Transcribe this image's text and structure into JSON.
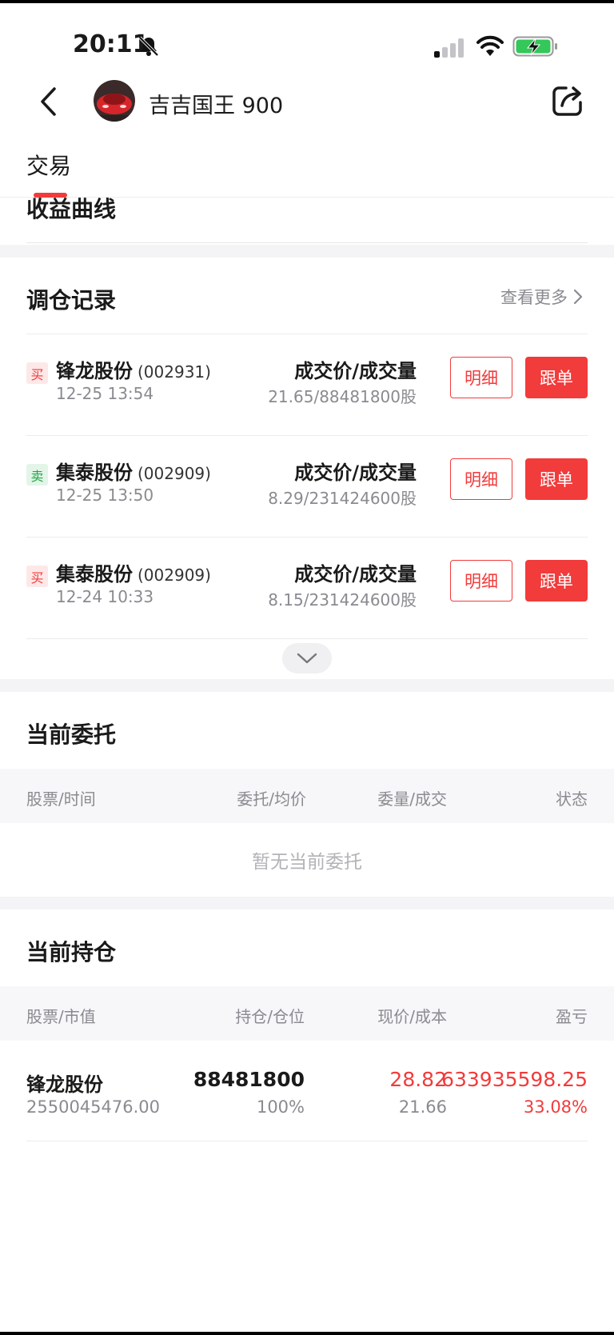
{
  "status_bar": {
    "time": "20:11",
    "icons": [
      "bell-off-icon",
      "signal-icon",
      "wifi-icon",
      "battery-charging-icon"
    ]
  },
  "header": {
    "user_name": "吉吉国王 900",
    "back_icon": "chevron-left-icon",
    "share_icon": "share-icon"
  },
  "tabs": [
    {
      "label": "交易",
      "active": true
    }
  ],
  "curve_section": {
    "title": "收益曲线"
  },
  "trade_records": {
    "title": "调仓记录",
    "more_label": "查看更多",
    "price_label": "成交价/成交量",
    "detail_label": "明细",
    "follow_label": "跟单",
    "items": [
      {
        "side": "买",
        "type": "buy",
        "name": "锋龙股份",
        "code": "(002931)",
        "time": "12-25 13:54",
        "price_volume": "21.65/88481800股"
      },
      {
        "side": "卖",
        "type": "sell",
        "name": "集泰股份",
        "code": "(002909)",
        "time": "12-25 13:50",
        "price_volume": "8.29/231424600股"
      },
      {
        "side": "买",
        "type": "buy",
        "name": "集泰股份",
        "code": "(002909)",
        "time": "12-24 10:33",
        "price_volume": "8.15/231424600股"
      }
    ]
  },
  "current_orders": {
    "title": "当前委托",
    "columns": [
      "股票/时间",
      "委托/均价",
      "委量/成交",
      "状态"
    ],
    "empty_text": "暂无当前委托"
  },
  "current_holdings": {
    "title": "当前持仓",
    "columns": [
      "股票/市值",
      "持仓/仓位",
      "现价/成本",
      "盈亏"
    ],
    "rows": [
      {
        "name": "锋龙股份",
        "market_value": "2550045476.00",
        "quantity": "88481800",
        "position": "100%",
        "price": "28.82",
        "cost": "21.66",
        "profit": "633935598.25",
        "profit_pct": "33.08%"
      }
    ]
  },
  "colors": {
    "accent": "#f23b3b",
    "sell_green": "#21a848",
    "muted": "#8a8a90"
  }
}
